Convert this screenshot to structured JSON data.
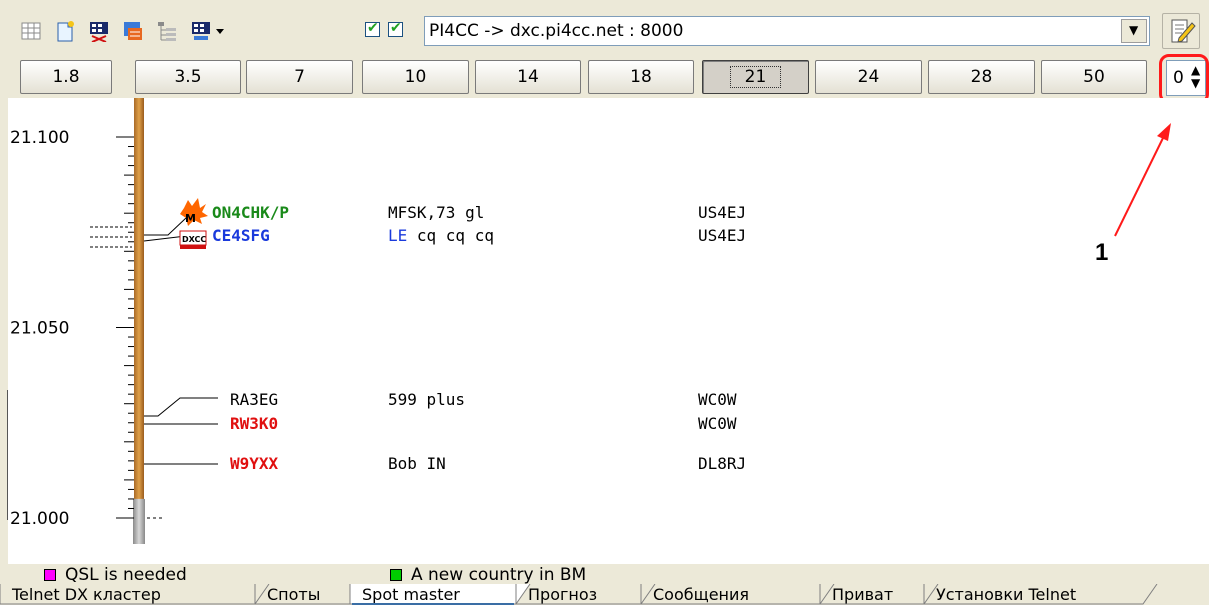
{
  "toolbar": {
    "icons": [
      "grid-icon",
      "new-document-icon",
      "table-settings-icon",
      "filter-icon",
      "tree-icon",
      "table-export-icon",
      "dropdown-arrow-icon"
    ],
    "checkbox1_checked": true,
    "checkbox2_checked": true,
    "cluster_connection": "PI4CC -> dxc.pi4cc.net : 8000",
    "combo_arrow": "▼"
  },
  "bands": {
    "items": [
      "1.8",
      "3.5",
      "7",
      "10",
      "14",
      "18",
      "21",
      "24",
      "28",
      "50"
    ],
    "active": "21",
    "spin_value": "0",
    "spin_arrows": "▲\n▼"
  },
  "annotation": {
    "label": "1",
    "color": "#ff1a1a"
  },
  "scale": {
    "top_label": "21.100",
    "mid_label": "21.050",
    "bottom_label": "21.000",
    "min_mhz": 21.0,
    "max_mhz": 21.1
  },
  "spots": [
    {
      "call": "ON4CHK/P",
      "freq": 21.08,
      "comment": "MFSK,73 gl",
      "spotter": "US4EJ",
      "call_color": "#1a8a1a",
      "comment_color": "#000000",
      "badge": "M",
      "new": true
    },
    {
      "call": "CE4SFG",
      "freq": 21.078,
      "comment": "LE cq cq cq",
      "comment_prefix": "LE",
      "comment_rest": " cq cq cq",
      "spotter": "US4EJ",
      "call_color": "#1a3adc",
      "comment_color": "#1a3adc",
      "badge": "DXCC"
    },
    {
      "call": "RA3EG",
      "freq": 21.027,
      "comment": "599 plus",
      "spotter": "WC0W",
      "call_color": "#000000",
      "comment_color": "#000000"
    },
    {
      "call": "RW3K0",
      "freq": 21.023,
      "comment": "",
      "spotter": "WC0W",
      "call_color": "#e01010",
      "comment_color": "#000000"
    },
    {
      "call": "W9YXX",
      "freq": 21.014,
      "comment": "Bob IN",
      "spotter": "DL8RJ",
      "call_color": "#e01010",
      "comment_color": "#000000"
    }
  ],
  "legend": {
    "qsl": {
      "label": "QSL is needed",
      "color": "#ff00ff"
    },
    "new_country": {
      "label": "A new country in BM",
      "color": "#00cc00"
    }
  },
  "tabs": [
    {
      "label": "Telnet DX кластер",
      "active": false
    },
    {
      "label": "Споты",
      "active": false
    },
    {
      "label": "Spot master",
      "active": true
    },
    {
      "label": "Прогноз",
      "active": false
    },
    {
      "label": "Сообщения",
      "active": false
    },
    {
      "label": "Приват",
      "active": false
    },
    {
      "label": "Установки Telnet",
      "active": false
    }
  ]
}
